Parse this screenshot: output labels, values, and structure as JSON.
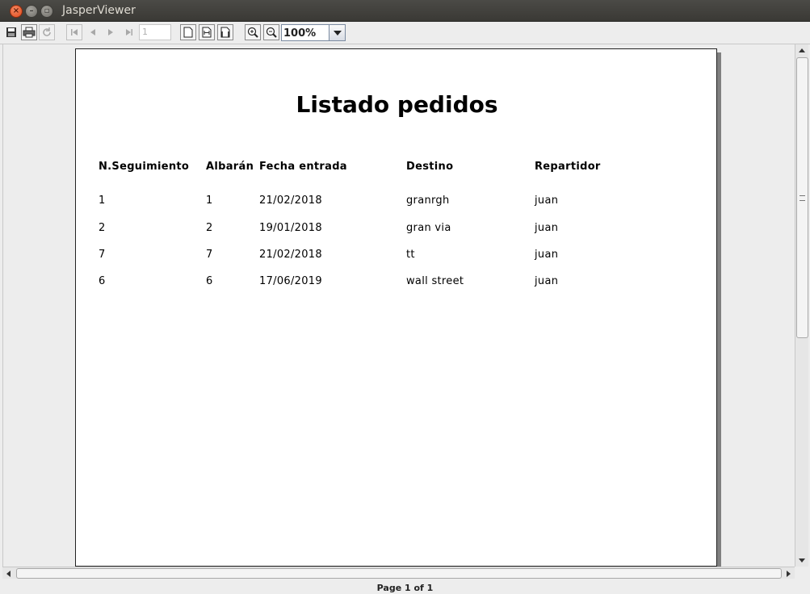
{
  "window": {
    "title": "JasperViewer"
  },
  "toolbar": {
    "page_number": "1",
    "zoom": "100%",
    "icons": [
      "save-icon",
      "print-icon",
      "reload-icon",
      "first-page-icon",
      "previous-page-icon",
      "next-page-icon",
      "last-page-icon",
      "actual-size-icon",
      "fit-page-icon",
      "fit-width-icon",
      "zoom-in-icon",
      "zoom-out-icon"
    ]
  },
  "report": {
    "title": "Listado pedidos",
    "columns": [
      "N.Seguimiento",
      "Albarán",
      "Fecha entrada",
      "Destino",
      "Repartidor"
    ],
    "rows": [
      [
        "1",
        "1",
        "21/02/2018",
        "granrgh",
        "juan"
      ],
      [
        "2",
        "2",
        "19/01/2018",
        "gran via",
        "juan"
      ],
      [
        "7",
        "7",
        "21/02/2018",
        "tt",
        "juan"
      ],
      [
        "6",
        "6",
        "17/06/2019",
        "wall street",
        "juan"
      ]
    ]
  },
  "status": {
    "page_info": "Page 1 of 1"
  }
}
